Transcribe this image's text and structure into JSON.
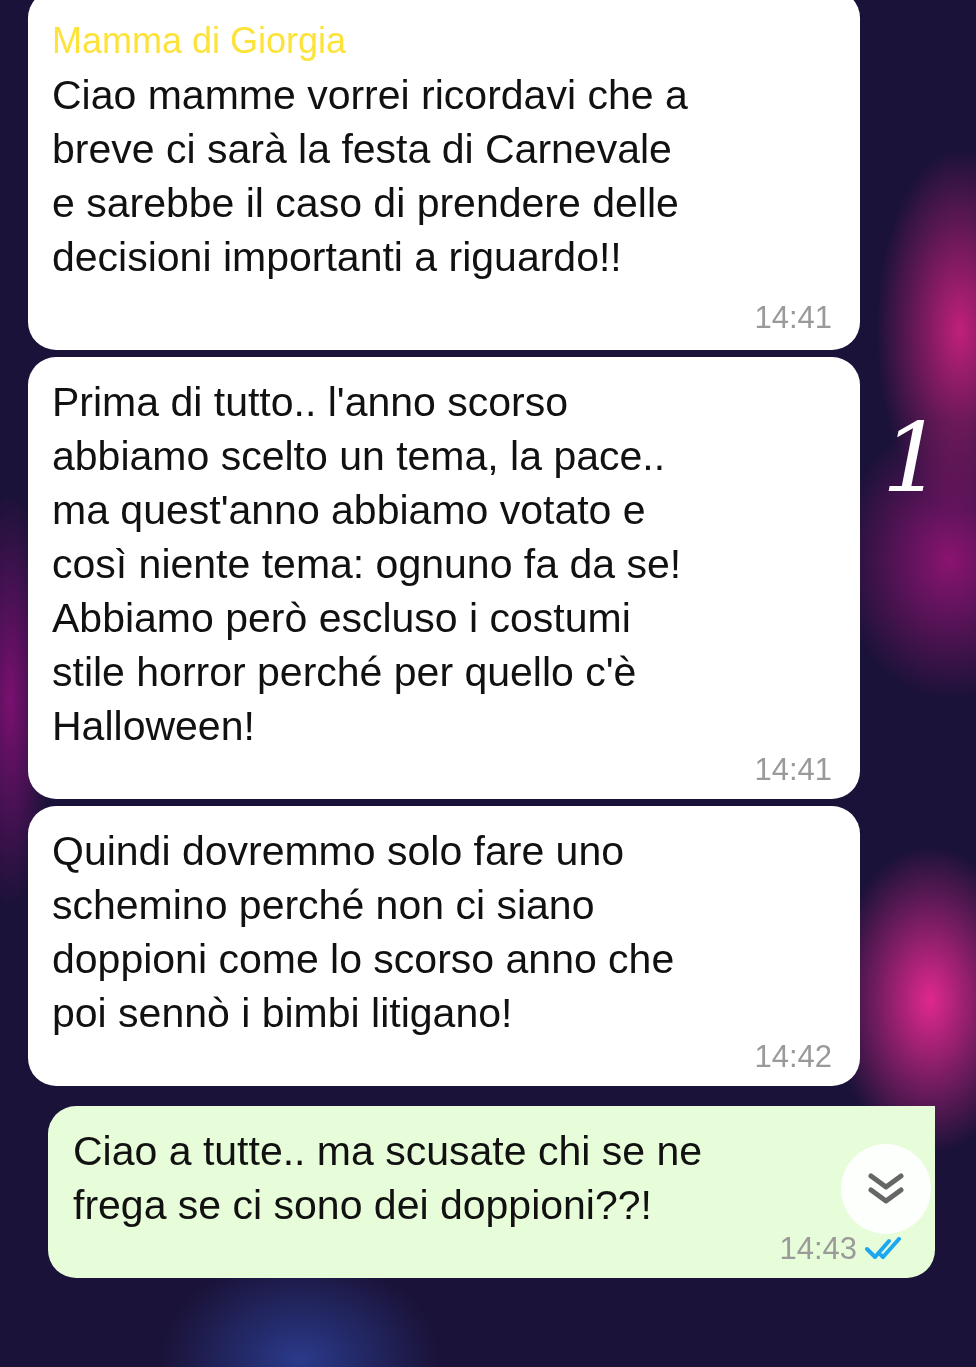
{
  "messages": [
    {
      "kind": "incoming",
      "sender": "Mamma di Giorgia",
      "text": "Ciao mamme vorrei ricordavi che a\nbreve ci sarà la festa di Carnevale\ne sarebbe il caso di prendere delle\ndecisioni importanti a riguardo!!",
      "time": "14:41"
    },
    {
      "kind": "incoming",
      "text": "Prima di tutto.. l'anno scorso\nabbiamo scelto un tema, la pace..\nma quest'anno abbiamo votato e\ncosì niente tema: ognuno fa da se!\nAbbiamo però escluso i costumi\nstile horror perché per quello c'è\nHalloween!",
      "time": "14:41"
    },
    {
      "kind": "incoming",
      "text": "Quindi dovremmo solo fare uno\nschemino perché non ci siano\ndoppioni come lo scorso anno che\npoi sennò i bimbi litigano!",
      "time": "14:42"
    },
    {
      "kind": "outgoing",
      "text": "Ciao a tutte.. ma scusate chi se ne\nfrega se ci sono dei doppioni??!",
      "time": "14:43",
      "read": true
    }
  ],
  "annotation": "1"
}
